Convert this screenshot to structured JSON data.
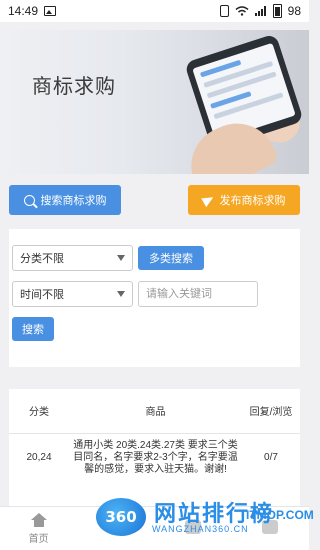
{
  "status_bar": {
    "time": "14:49",
    "battery": "98"
  },
  "banner": {
    "title": "商标求购"
  },
  "actions": {
    "search_label": "搜索商标求购",
    "publish_label": "发布商标求购"
  },
  "filters": {
    "category_value": "分类不限",
    "multi_search_label": "多类搜索",
    "time_value": "时间不限",
    "keyword_placeholder": "请输入关键词",
    "search_label": "搜索"
  },
  "table": {
    "headers": [
      "分类",
      "商品",
      "回复/浏览"
    ],
    "rows": [
      {
        "category": "20,24",
        "goods": "通用小类 20类.24类.27类 要求三个类目同名，名字要求2-3个字，名字要温馨的感觉，要求入驻天猫。谢谢!",
        "stats": "0/7"
      }
    ]
  },
  "bottom_nav": {
    "home_label": "首页"
  },
  "watermark": {
    "logo": "360",
    "text": "网站排行榜",
    "site": "ITMOP.COM",
    "sub": "WANGZHAN360.CN"
  }
}
